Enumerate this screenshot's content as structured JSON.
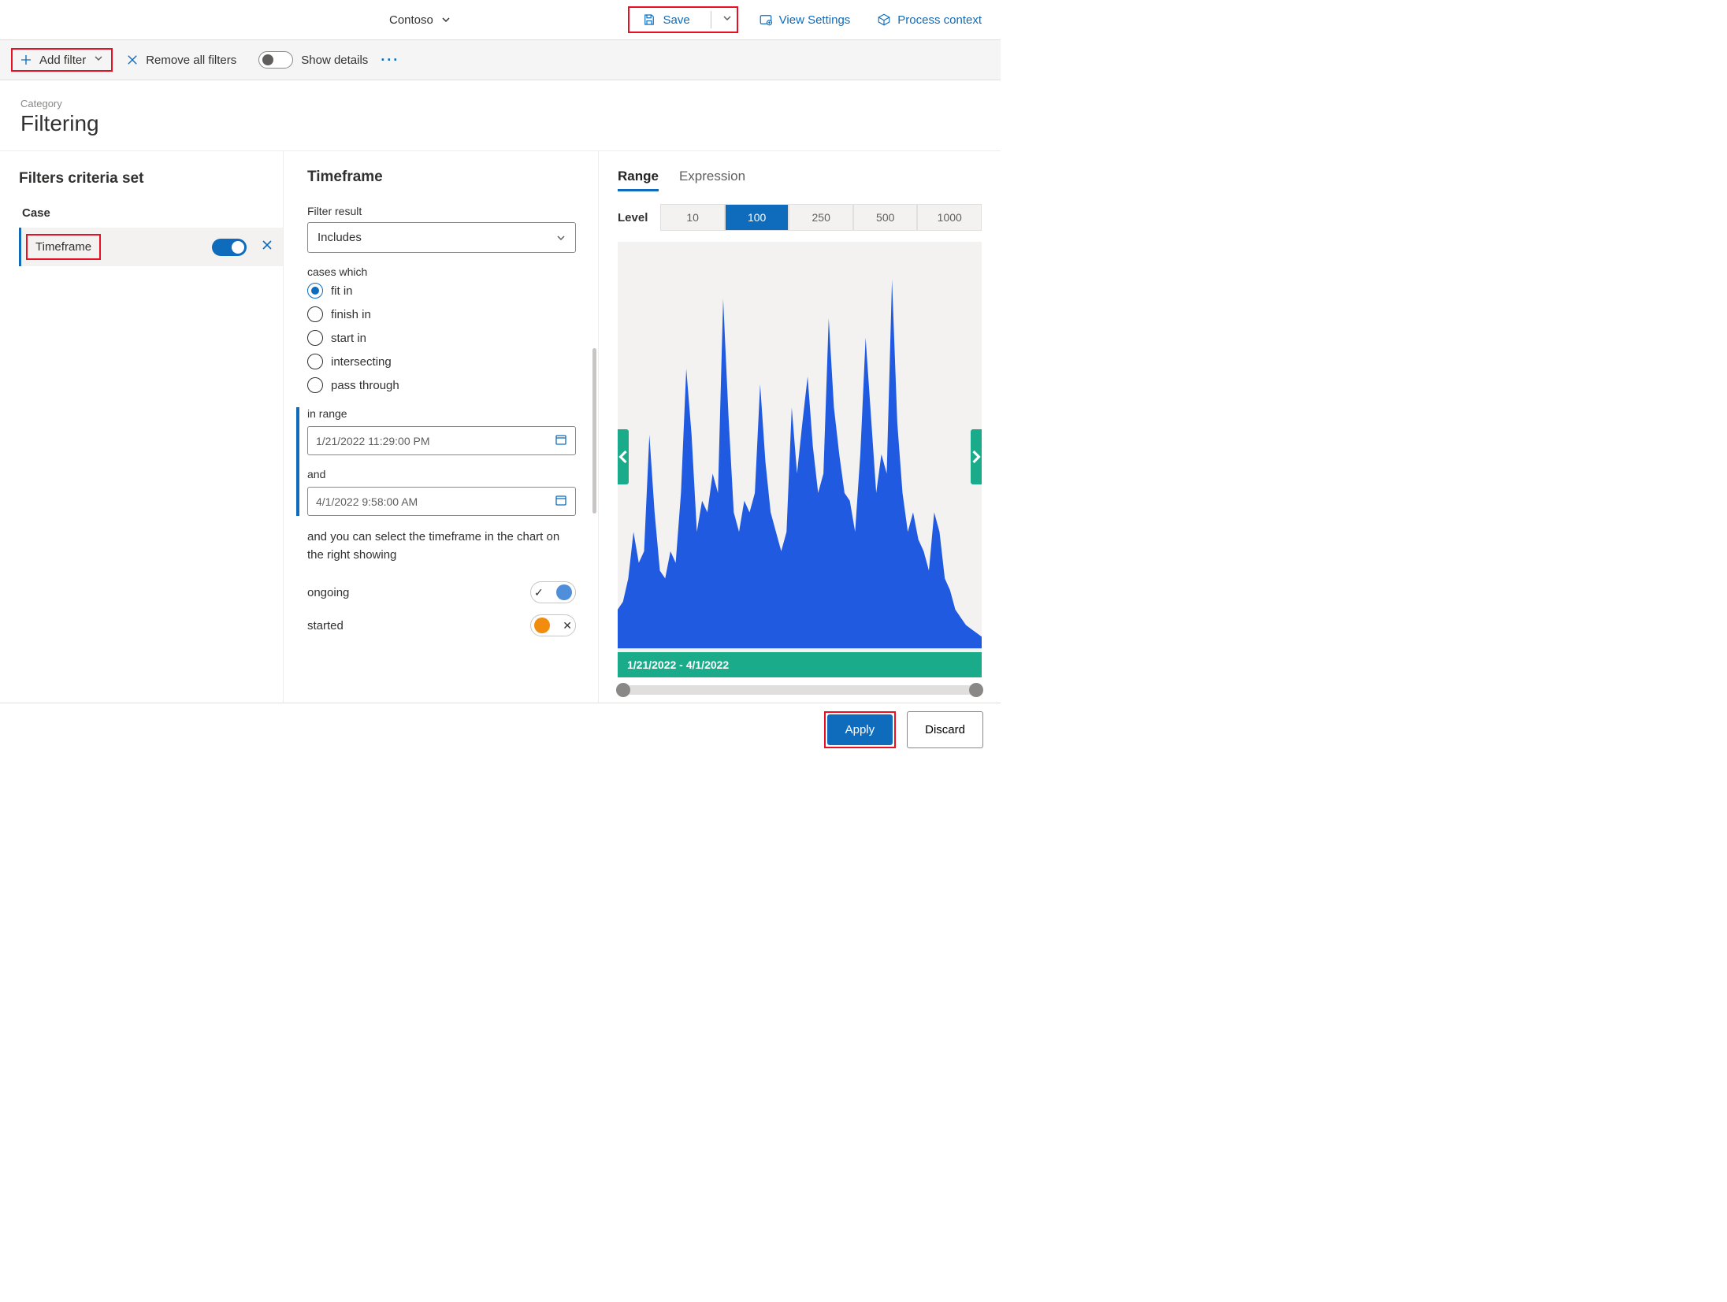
{
  "header": {
    "org_name": "Contoso",
    "save_label": "Save",
    "view_settings_label": "View Settings",
    "process_context_label": "Process context"
  },
  "toolbar": {
    "add_filter_label": "Add filter",
    "remove_all_label": "Remove all filters",
    "show_details_label": "Show details"
  },
  "category": {
    "label": "Category",
    "title": "Filtering"
  },
  "left": {
    "title": "Filters criteria set",
    "section_label": "Case",
    "filter_name": "Timeframe"
  },
  "center": {
    "title": "Timeframe",
    "filter_result_label": "Filter result",
    "filter_result_value": "Includes",
    "cases_which_label": "cases which",
    "radios": {
      "fit_in": "fit in",
      "finish_in": "finish in",
      "start_in": "start in",
      "intersecting": "intersecting",
      "pass_through": "pass through"
    },
    "in_range_label": "in range",
    "start_date": "1/21/2022 11:29:00 PM",
    "and_label": "and",
    "end_date": "4/1/2022 9:58:00 AM",
    "help_text": "and you can select the timeframe in the chart on the right showing",
    "legend": {
      "ongoing": "ongoing",
      "started": "started"
    }
  },
  "right": {
    "tabs": {
      "range": "Range",
      "expression": "Expression"
    },
    "level_label": "Level",
    "levels": [
      "10",
      "100",
      "250",
      "500",
      "1000"
    ],
    "active_level": "100",
    "date_range_caption": "1/21/2022 - 4/1/2022"
  },
  "bottom": {
    "apply": "Apply",
    "discard": "Discard"
  },
  "chart_data": {
    "type": "area",
    "title": "",
    "xlabel": "",
    "ylabel": "",
    "x_range": [
      "1/21/2022",
      "4/1/2022"
    ],
    "ylim": [
      0,
      100
    ],
    "series": [
      {
        "name": "ongoing",
        "color": "#1f5ae0",
        "values": [
          10,
          12,
          18,
          30,
          22,
          25,
          55,
          35,
          20,
          18,
          25,
          22,
          40,
          72,
          55,
          30,
          38,
          35,
          45,
          40,
          90,
          60,
          35,
          30,
          38,
          35,
          40,
          68,
          48,
          35,
          30,
          25,
          30,
          62,
          45,
          58,
          70,
          52,
          40,
          45,
          85,
          62,
          50,
          40,
          38,
          30,
          50,
          80,
          60,
          40,
          50,
          45,
          95,
          58,
          40,
          30,
          35,
          28,
          25,
          20,
          35,
          30,
          18,
          15,
          10,
          8,
          6,
          5,
          4,
          3
        ]
      }
    ]
  }
}
